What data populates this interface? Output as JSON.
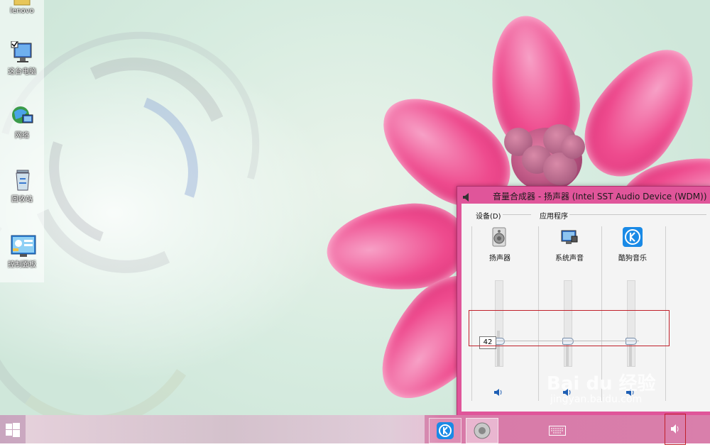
{
  "desktop": {
    "icons": [
      {
        "label": "lenovo",
        "icon": "folder-icon"
      },
      {
        "label": "这台电脑",
        "icon": "computer-icon"
      },
      {
        "label": "网络",
        "icon": "network-icon"
      },
      {
        "label": "回收站",
        "icon": "recycle-bin-icon"
      },
      {
        "label": "控制面板",
        "icon": "control-panel-icon"
      }
    ]
  },
  "mixer": {
    "title": "音量合成器 - 扬声器 (Intel SST Audio Device (WDM))",
    "device_group": "设备(D)",
    "apps_group": "应用程序",
    "channels": [
      {
        "name": "扬声器",
        "icon": "speaker-device-icon",
        "level": 42
      },
      {
        "name": "系统声音",
        "icon": "system-sounds-icon",
        "level": 42
      },
      {
        "name": "酷狗音乐",
        "icon": "kugou-icon",
        "level": 42
      }
    ],
    "volume_tooltip": "42"
  },
  "taskbar": {
    "apps": [
      {
        "name": "kugou-app",
        "icon": "kugou-icon"
      },
      {
        "name": "volume-mixer-app",
        "icon": "speaker-device-icon"
      }
    ],
    "tray": [
      "keyboard-icon",
      "volume-icon"
    ]
  },
  "watermark": {
    "brand": "Bai du 经验",
    "url": "jingyan.baidu.com"
  },
  "colors": {
    "accent": "#e0559a",
    "highlight_box": "#c0202a",
    "kugou": "#1a8ae6"
  }
}
